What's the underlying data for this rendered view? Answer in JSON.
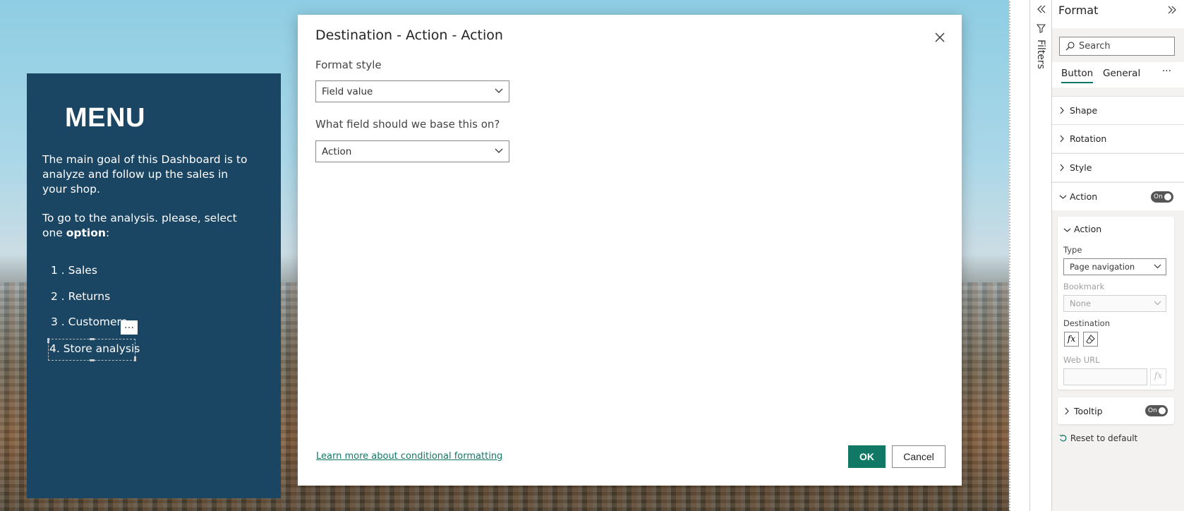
{
  "menu": {
    "title": "MENU",
    "paragraph1": "The main goal of this Dashboard is to analyze and follow up the sales in your shop.",
    "paragraph2_prefix": "To go to the analysis. please, select one ",
    "paragraph2_bold": "option",
    "paragraph2_suffix": ":",
    "items": [
      "1 . Sales",
      "2 . Returns",
      "3 . Customers",
      "4. Store analysis"
    ],
    "more_options": "…"
  },
  "dialog": {
    "title": "Destination - Action - Action",
    "format_style_label": "Format style",
    "format_style_value": "Field value",
    "field_label": "What field should we base this on?",
    "field_value": "Action",
    "learn_more": "Learn more about conditional formatting",
    "ok": "OK",
    "cancel": "Cancel"
  },
  "filters": {
    "label": "Filters"
  },
  "format": {
    "title": "Format",
    "search_placeholder": "Search",
    "tabs": [
      "Button",
      "General"
    ],
    "more": "···",
    "sections": [
      "Shape",
      "Rotation",
      "Style",
      "Action"
    ],
    "action_toggle": "On",
    "action_card": {
      "header": "Action",
      "type_label": "Type",
      "type_value": "Page navigation",
      "bookmark_label": "Bookmark",
      "bookmark_value": "None",
      "destination_label": "Destination",
      "fx": "fx",
      "web_url_label": "Web URL"
    },
    "tooltip": {
      "label": "Tooltip",
      "toggle": "On"
    },
    "reset": "Reset to default"
  },
  "colors": {
    "menu_bg": "#1a4563",
    "accent": "#117865"
  }
}
